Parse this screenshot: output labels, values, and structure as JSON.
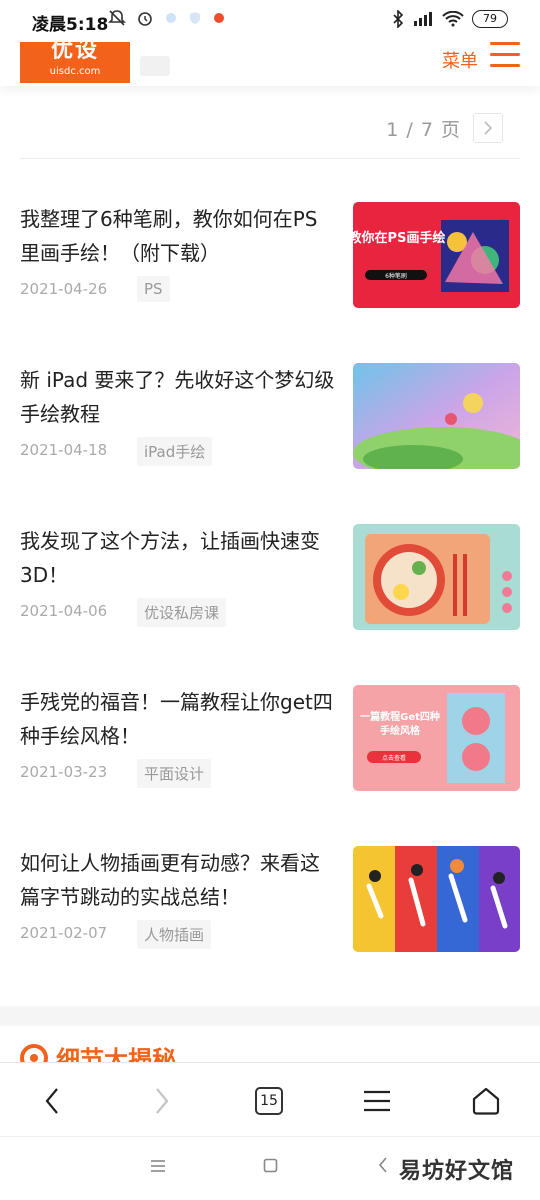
{
  "status_bar": {
    "time": "凌晨5:18",
    "battery": "79"
  },
  "header": {
    "logo_name": "优设",
    "logo_url": "uisdc.com",
    "menu_label": "菜单"
  },
  "pager": {
    "text": "1 / 7 页"
  },
  "articles": [
    {
      "title": "我整理了6种笔刷，教你如何在PS里画手绘！（附下载）",
      "date": "2021-04-26",
      "tag": "PS",
      "thumb_text": "教你在PS画手绘",
      "thumb_sub": "6种笔刷"
    },
    {
      "title": "新 iPad 要来了？先收好这个梦幻级手绘教程",
      "date": "2021-04-18",
      "tag": "iPad手绘"
    },
    {
      "title": "我发现了这个方法，让插画快速变3D！",
      "date": "2021-04-06",
      "tag": "优设私房课"
    },
    {
      "title": "手残党的福音！一篇教程让你get四种手绘风格！",
      "date": "2021-03-23",
      "tag": "平面设计",
      "thumb_text": "一篇教程Get四种手绘风格",
      "thumb_sub": "点击查看"
    },
    {
      "title": "如何让人物插画更有动感？来看这篇字节跳动的实战总结！",
      "date": "2021-02-07",
      "tag": "人物插画"
    }
  ],
  "section": {
    "heading": "细节大揭秘"
  },
  "browser_bar": {
    "tab_count": "15"
  },
  "watermark": "易坊好文馆",
  "colors": {
    "brand": "#f3621a",
    "text": "#222222",
    "muted": "#aaaaaa"
  }
}
